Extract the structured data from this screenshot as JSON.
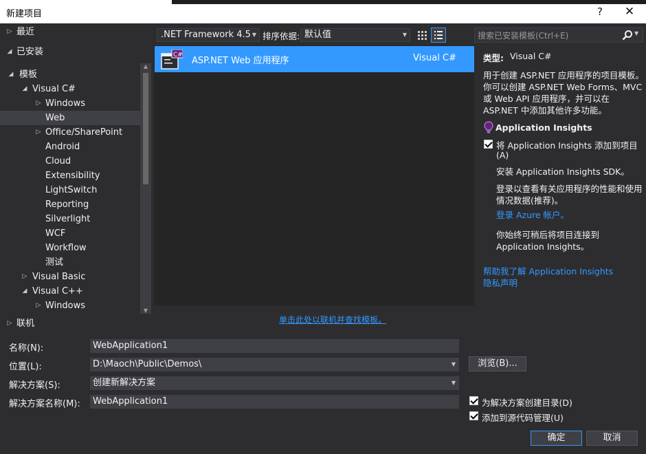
{
  "window": {
    "title": "新建项目",
    "help_label": "?",
    "close_label": "✕"
  },
  "tree": {
    "recent": "最近",
    "installed": "已安装",
    "templates": "模板",
    "visual_csharp": "Visual C#",
    "csharp_children": [
      "Windows",
      "Web",
      "Office/SharePoint",
      "Android",
      "Cloud",
      "Extensibility",
      "LightSwitch",
      "Reporting",
      "Silverlight",
      "WCF",
      "Workflow",
      "测试"
    ],
    "visual_basic": "Visual Basic",
    "visual_cpp": "Visual C++",
    "cpp_windows": "Windows",
    "online": "联机",
    "selected": "Web"
  },
  "toolbar": {
    "framework": ".NET Framework 4.5",
    "sort_label": "排序依据:",
    "sort_value": "默认值"
  },
  "templates": [
    {
      "name": "ASP.NET Web 应用程序",
      "language": "Visual C#",
      "icon": "aspnet-web-app-icon"
    }
  ],
  "online_link": "单击此处以联机并查找模板。",
  "search": {
    "placeholder": "搜索已安装模板(Ctrl+E)"
  },
  "details": {
    "type_label": "类型:",
    "type_value": "Visual C#",
    "description": [
      "用于创建 ASP.NET 应用程序的项目模板。",
      "你可以创建 ASP.NET Web Forms、MVC",
      "或 Web API 应用程序，并可以在",
      "ASP.NET 中添加其他许多功能。"
    ],
    "ai_title": "Application Insights",
    "ai_check_label": [
      "将 Application Insights 添加到项目",
      "(A)"
    ],
    "ai_check_checked": true,
    "sdk_text": "安装 Application Insights SDK。",
    "login_text": [
      "登录以查看有关应用程序的性能和使用",
      "情况数据(推荐)。"
    ],
    "azure_link": "登录 Azure 帐户。",
    "later_text": [
      "你始终可稍后将项目连接到",
      "Application Insights。"
    ],
    "help_link": "帮助我了解 Application Insights",
    "privacy_link": "隐私声明"
  },
  "form": {
    "name_label": "名称(N):",
    "name_value": "WebApplication1",
    "location_label": "位置(L):",
    "location_value": "D:\\Maoch\\Public\\Demos\\",
    "browse_label": "浏览(B)...",
    "solution_label": "解决方案(S):",
    "solution_value": "创建新解决方案",
    "solution_name_label": "解决方案名称(M):",
    "solution_name_value": "WebApplication1",
    "create_dir_label": "为解决方案创建目录(D)",
    "create_dir_checked": true,
    "source_control_label": "添加到源代码管理(U)",
    "source_control_checked": true,
    "ok_label": "确定",
    "cancel_label": "取消"
  },
  "colors": {
    "accent": "#3399ff",
    "background": "#2d2d30",
    "panel": "#252526"
  }
}
